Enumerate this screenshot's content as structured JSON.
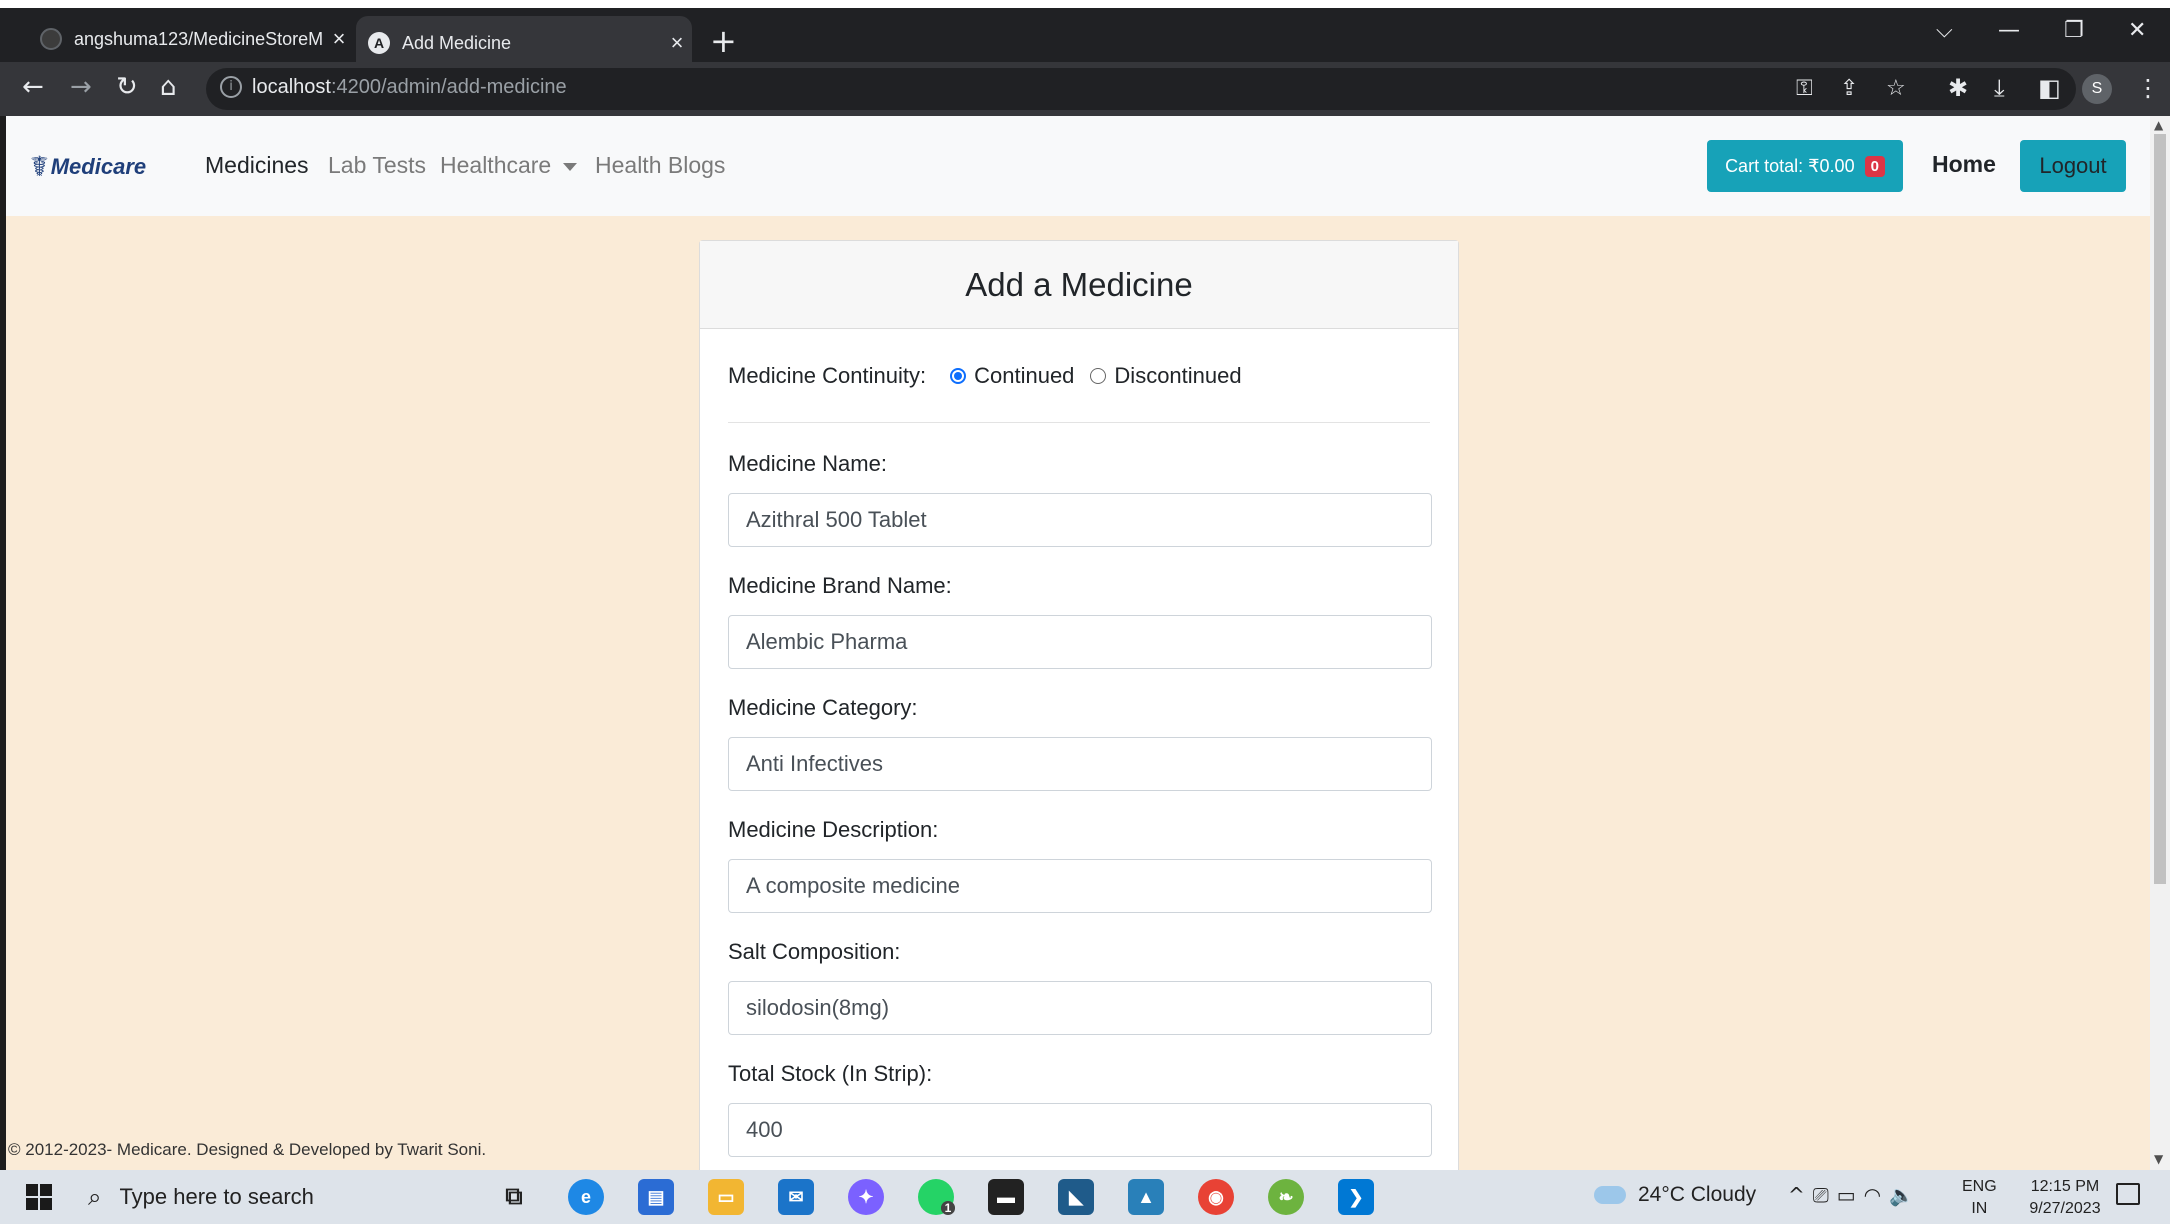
{
  "browser": {
    "tabs": [
      {
        "title": "angshuma123/MedicineStoreM",
        "active": false,
        "favicon": "github-icon"
      },
      {
        "title": "Add Medicine",
        "active": true,
        "favicon": "angular-icon",
        "favicon_letter": "A"
      }
    ],
    "url_host": "localhost",
    "url_path": ":4200/admin/add-medicine",
    "profile_initial": "S"
  },
  "navbar": {
    "brand": "Medicare",
    "links": [
      {
        "label": "Medicines",
        "active": true
      },
      {
        "label": "Lab Tests",
        "active": false
      },
      {
        "label": "Healthcare",
        "active": false,
        "dropdown": true
      },
      {
        "label": "Health Blogs",
        "active": false
      }
    ],
    "cart_label": "Cart total: ₹0.00",
    "cart_count": "0",
    "home_label": "Home",
    "logout_label": "Logout"
  },
  "form": {
    "title": "Add a Medicine",
    "continuity_label": "Medicine Continuity:",
    "continuity_options": [
      {
        "label": "Continued",
        "checked": true
      },
      {
        "label": "Discontinued",
        "checked": false
      }
    ],
    "fields": [
      {
        "label": "Medicine Name:",
        "value": "Azithral 500 Tablet"
      },
      {
        "label": "Medicine Brand Name:",
        "value": "Alembic Pharma"
      },
      {
        "label": "Medicine Category:",
        "value": "Anti Infectives"
      },
      {
        "label": "Medicine Description:",
        "value": "A composite medicine"
      },
      {
        "label": "Salt Composition:",
        "value": "silodosin(8mg)"
      },
      {
        "label": "Total Stock (In Strip):",
        "value": "400"
      }
    ]
  },
  "footer": "© 2012-2023- Medicare. Designed & Developed by Twarit Soni.",
  "taskbar": {
    "search_placeholder": "Type here to search",
    "whatsapp_badge": "1",
    "weather": "24°C  Cloudy",
    "lang_line1": "ENG",
    "lang_line2": "IN",
    "time": "12:15 PM",
    "date": "9/27/2023"
  },
  "colors": {
    "accent": "#17a2b8",
    "badge": "#dc3545",
    "page_bg": "#faebd7"
  }
}
